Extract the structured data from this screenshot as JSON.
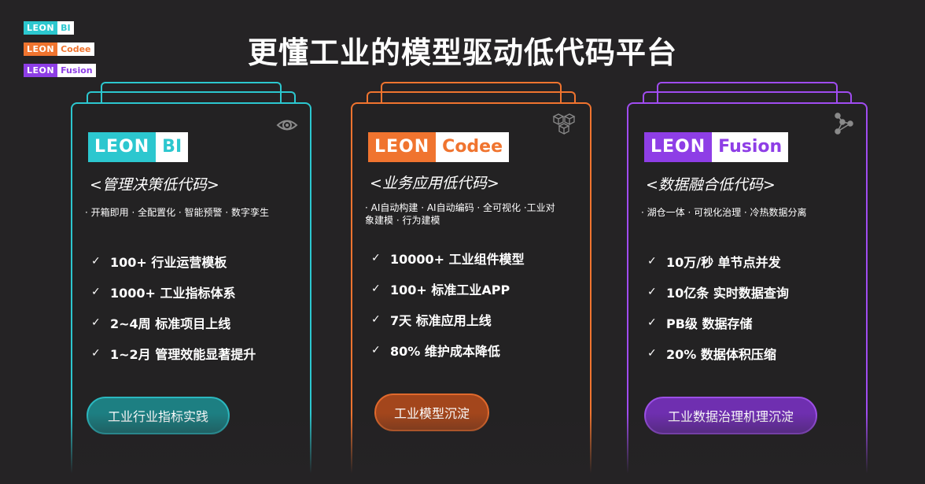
{
  "title": "更懂工业的模型驱动低代码平台",
  "mini_logos": [
    {
      "leon": "LEON",
      "product": "BI"
    },
    {
      "leon": "LEON",
      "product": "Codee"
    },
    {
      "leon": "LEON",
      "product": "Fusion"
    }
  ],
  "cards": [
    {
      "leon": "LEON",
      "product": "BI",
      "icon": "eye-icon",
      "subtitle": "<管理决策低代码>",
      "features": "· 开箱即用 · 全配置化 · 智能预警 · 数字孪生",
      "items": [
        "100+ 行业运营模板",
        "1000+ 工业指标体系",
        "2~4周 标准项目上线",
        "1~2月 管理效能显著提升"
      ],
      "button": "工业行业指标实践",
      "accent": "#2cc7cf"
    },
    {
      "leon": "LEON",
      "product": "Codee",
      "icon": "cubes-icon",
      "subtitle": "<业务应用低代码>",
      "features": "· AI自动构建 · AI自动编码 · 全可视化 ·工业对象建模 · 行为建模",
      "items": [
        "10000+ 工业组件模型",
        "100+ 标准工业APP",
        "7天 标准应用上线",
        "80% 维护成本降低"
      ],
      "button": "工业模型沉淀",
      "accent": "#f0742f"
    },
    {
      "leon": "LEON",
      "product": "Fusion",
      "icon": "network-icon",
      "subtitle": "<数据融合低代码>",
      "features": "· 湖仓一体 · 可视化治理 · 冷热数据分离",
      "items": [
        "10万/秒 单节点并发",
        "10亿条 实时数据查询",
        "PB级 数据存储",
        "20% 数据体积压缩"
      ],
      "button": "工业数据治理机理沉淀",
      "accent": "#a04cf0"
    }
  ],
  "check_mark": "✓"
}
